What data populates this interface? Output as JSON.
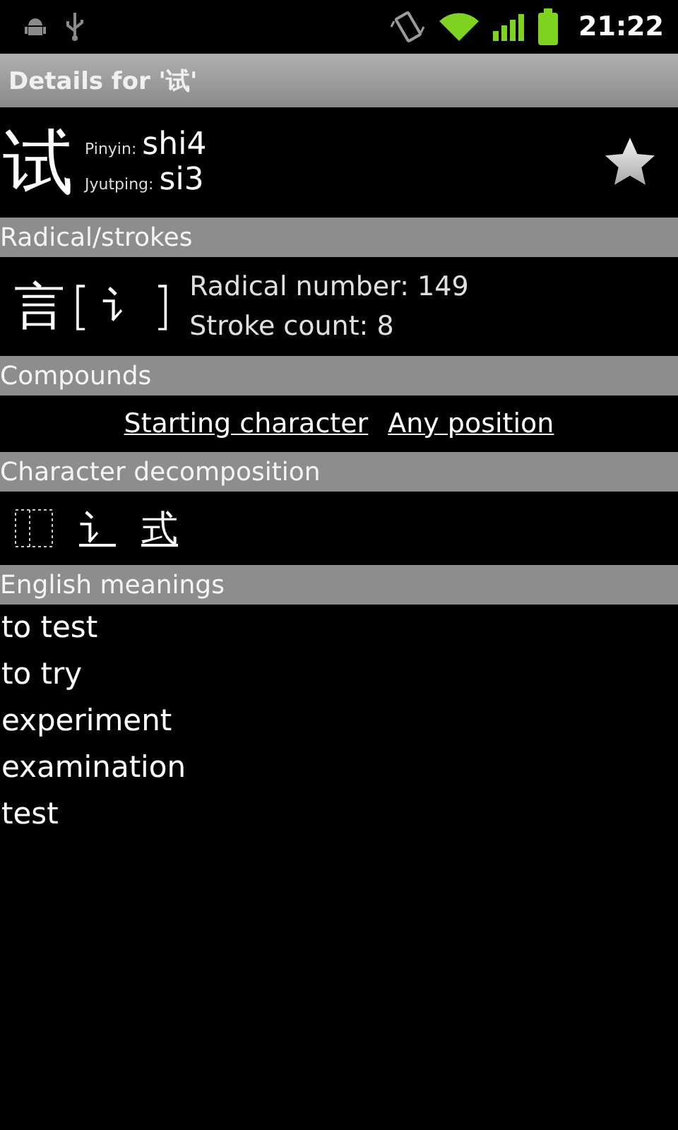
{
  "status_bar": {
    "time": "21:22"
  },
  "title_bar": {
    "title": "Details for '试'"
  },
  "entry": {
    "character": "试",
    "pinyin_label": "Pinyin:",
    "pinyin": "shi4",
    "jyutping_label": "Jyutping:",
    "jyutping": "si3",
    "starred": false
  },
  "radical_section": {
    "heading": "Radical/strokes",
    "radical": "言",
    "bracket_open": "[",
    "radical_variant": "讠",
    "bracket_close": "]",
    "radical_number": "Radical number: 149",
    "stroke_count": "Stroke count: 8"
  },
  "compounds_section": {
    "heading": "Compounds",
    "links": [
      "Starting character",
      "Any position"
    ]
  },
  "decomposition_section": {
    "heading": "Character decomposition",
    "parts": [
      "讠",
      "式"
    ]
  },
  "meanings_section": {
    "heading": "English meanings",
    "meanings": [
      "to test",
      "to try",
      "experiment",
      "examination",
      "test"
    ]
  }
}
